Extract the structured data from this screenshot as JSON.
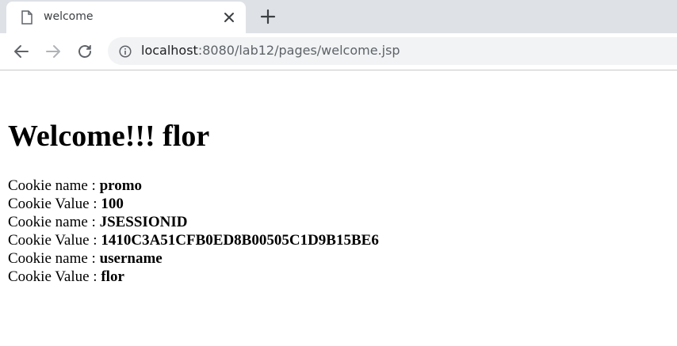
{
  "browser": {
    "tab_title": "welcome",
    "url_host": "localhost",
    "url_rest": ":8080/lab12/pages/welcome.jsp"
  },
  "page": {
    "heading": "Welcome!!! flor",
    "cookies": [
      {
        "label": "Cookie name : ",
        "value": "promo"
      },
      {
        "label": "Cookie Value : ",
        "value": "100"
      },
      {
        "label": "Cookie name : ",
        "value": "JSESSIONID"
      },
      {
        "label": "Cookie Value : ",
        "value": "1410C3A51CFB0ED8B00505C1D9B15BE6"
      },
      {
        "label": "Cookie name : ",
        "value": "username"
      },
      {
        "label": "Cookie Value : ",
        "value": "flor"
      }
    ]
  },
  "icons": {
    "tab": "document-icon",
    "close": "close-icon",
    "new_tab": "plus-icon",
    "back": "back-arrow-icon",
    "forward": "forward-arrow-icon",
    "reload": "reload-icon",
    "site_info": "info-icon"
  }
}
